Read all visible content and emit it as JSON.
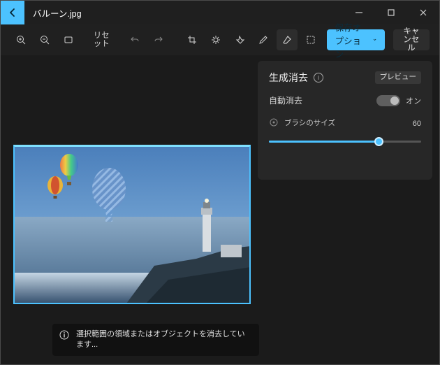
{
  "titlebar": {
    "filename": "バルーン.jpg"
  },
  "toolbar": {
    "reset": "リセット",
    "save": "保存オプション",
    "cancel": "キャンセル"
  },
  "panel": {
    "title": "生成消去",
    "preview_chip": "プレビュー",
    "auto_erase": "自動消去",
    "switch_state": "オン",
    "brush_label": "ブラシのサイズ",
    "brush_value": "60"
  },
  "tip": {
    "text": "選択範囲の領域またはオブジェクトを消去しています..."
  }
}
